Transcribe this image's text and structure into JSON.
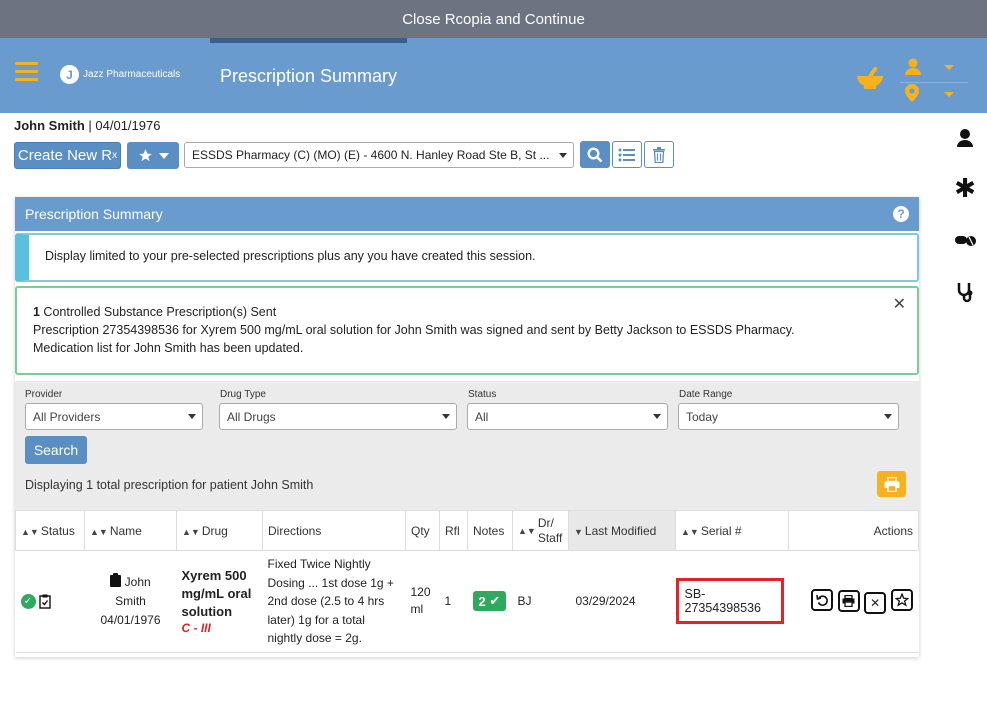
{
  "topbar": {
    "label": "Close Rcopia and Continue"
  },
  "header": {
    "logo_text": "Jazz Pharmaceuticals",
    "title": "Prescription Summary"
  },
  "patient": {
    "name": "John Smith",
    "dob": "| 04/01/1976"
  },
  "toolbar": {
    "create_label": "Create New R",
    "create_sub": "x",
    "pharmacy": "ESSDS Pharmacy (C) (MO) (E) - 4600 N. Hanley Road Ste B, St ..."
  },
  "panel": {
    "title": "Prescription Summary",
    "info_text": "Display limited to your pre-selected prescriptions plus any you have created this session.",
    "success": {
      "count": "1",
      "line1_rest": " Controlled Substance Prescription(s) Sent",
      "line2": "Prescription 27354398536 for Xyrem 500 mg/mL oral solution for John Smith was signed and sent by Betty Jackson to ESSDS Pharmacy.",
      "line3": "Medication list for John Smith has been updated."
    }
  },
  "filters": {
    "provider": {
      "label": "Provider",
      "value": "All Providers"
    },
    "drug_type": {
      "label": "Drug Type",
      "value": "All Drugs"
    },
    "status": {
      "label": "Status",
      "value": "All"
    },
    "date_range": {
      "label": "Date Range",
      "value": "Today"
    },
    "search_label": "Search",
    "display_text": "Displaying 1 total prescription for patient John Smith"
  },
  "table": {
    "headers": {
      "status": "Status",
      "name": "Name",
      "drug": "Drug",
      "directions": "Directions",
      "qty": "Qty",
      "rfl": "Rfl",
      "notes": "Notes",
      "dr_staff_1": "Dr/",
      "dr_staff_2": "Staff",
      "last_modified": "Last Modified",
      "serial": "Serial #",
      "actions": "Actions"
    },
    "rows": [
      {
        "name_first": "John",
        "name_last": "Smith",
        "dob": "04/01/1976",
        "drug_line1": "Xyrem 500",
        "drug_line2": "mg/mL oral",
        "drug_line3": "solution",
        "schedule": "C - III",
        "directions": "Fixed Twice Nightly Dosing ... 1st dose 1g + 2nd dose (2.5 to 4 hrs later) 1g for a total nightly dose = 2g.",
        "qty_1": "120",
        "qty_2": "ml",
        "rfl": "1",
        "notes_count": "2",
        "dr_staff": "BJ",
        "last_modified": "03/29/2024",
        "serial": "SB-27354398536"
      }
    ]
  },
  "colors": {
    "header_blue": "#6a9bcf",
    "accent_yellow": "#f5b21e",
    "success_green": "#2daa5e",
    "highlight_red": "#e3222a"
  }
}
